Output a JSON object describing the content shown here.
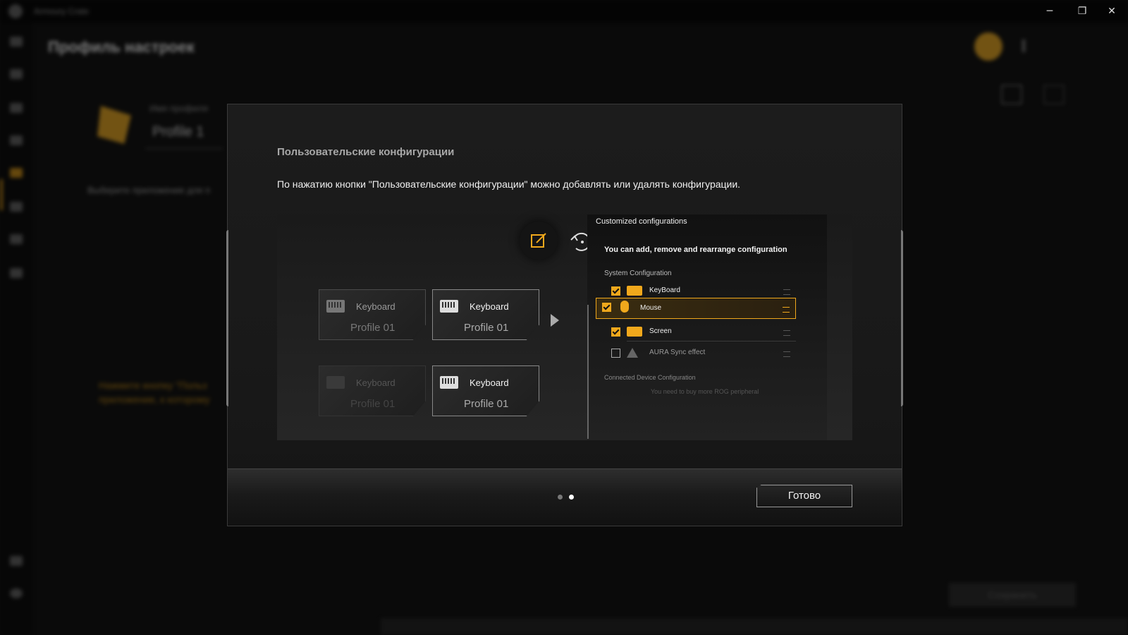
{
  "window": {
    "app_title": "Armoury Crate",
    "minimize_icon": "─",
    "restore_icon": "❐",
    "close_icon": "✕"
  },
  "background": {
    "page_title": "Профиль настроек",
    "profile_caption": "Имя профиля",
    "profile_name": "Profile 1",
    "hint": "Выберите приложение для п",
    "yellow_hint_line1": "Нажмите кнопку \"Польз",
    "yellow_hint_line2": "приложение, к которому",
    "save_button": "Сохранить"
  },
  "modal": {
    "title": "Пользовательские конфигурации",
    "description": "По нажатию кнопки \"Пользовательские конфигурации\" можно добавлять или удалять конфигурации.",
    "cards": [
      {
        "name": "Keyboard",
        "profile": "Profile 01"
      },
      {
        "name": "Keyboard",
        "profile": "Profile 01"
      },
      {
        "name": "Keyboard",
        "profile": "Profile 01"
      },
      {
        "name": "Keyboard",
        "profile": "Profile 01"
      }
    ],
    "config_panel": {
      "title": "Customized configurations",
      "subtitle": "You can add, remove and rearrange configuration",
      "system_label": "System Configuration",
      "rows": [
        {
          "label": "KeyBoard",
          "checked": true
        },
        {
          "label": "Mouse",
          "checked": true
        },
        {
          "label": "Screen",
          "checked": true
        },
        {
          "label": "AURA Sync effect",
          "checked": false
        }
      ],
      "connected_label": "Connected Device Configuration",
      "buy_note": "You need to buy more ROG peripheral"
    },
    "pagination": {
      "total": 2,
      "current": 2
    },
    "done_label": "Готово"
  },
  "colors": {
    "accent": "#f0a81c",
    "background": "#0a0a0a",
    "modal": "#1c1c1c"
  }
}
